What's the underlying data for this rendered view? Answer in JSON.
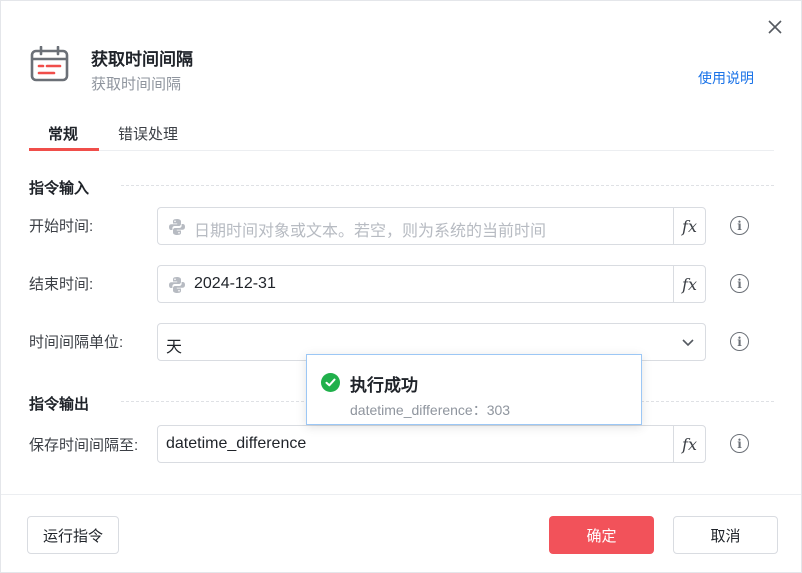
{
  "dialog": {
    "title": "获取时间间隔",
    "subtitle": "获取时间间隔",
    "help_link": "使用说明"
  },
  "tabs": [
    {
      "label": "常规",
      "active": true
    },
    {
      "label": "错误处理",
      "active": false
    }
  ],
  "sections": {
    "input_title": "指令输入",
    "output_title": "指令输出"
  },
  "fields": {
    "start_time": {
      "label": "开始时间:",
      "value": "",
      "placeholder": "日期时间对象或文本。若空，则为系统的当前时间"
    },
    "end_time": {
      "label": "结束时间:",
      "value": "2024-12-31"
    },
    "unit": {
      "label": "时间间隔单位:",
      "value": "天"
    },
    "save_to": {
      "label": "保存时间间隔至:",
      "value": "datetime_difference"
    }
  },
  "fx_label": "fx",
  "info_glyph": "i",
  "buttons": {
    "run": "运行指令",
    "ok": "确定",
    "cancel": "取消"
  },
  "toast": {
    "title": "执行成功",
    "message": "datetime_difference：303"
  },
  "colors": {
    "accent_red": "#f2525a",
    "tab_underline": "#f04e4a",
    "link_blue": "#1a73e8",
    "success_green": "#20b04b"
  },
  "icons": {
    "header": "calendar-icon",
    "close": "close-icon",
    "python": "python-icon",
    "dropdown": "chevron-down-icon",
    "info": "info-icon",
    "success": "check-circle-icon"
  }
}
